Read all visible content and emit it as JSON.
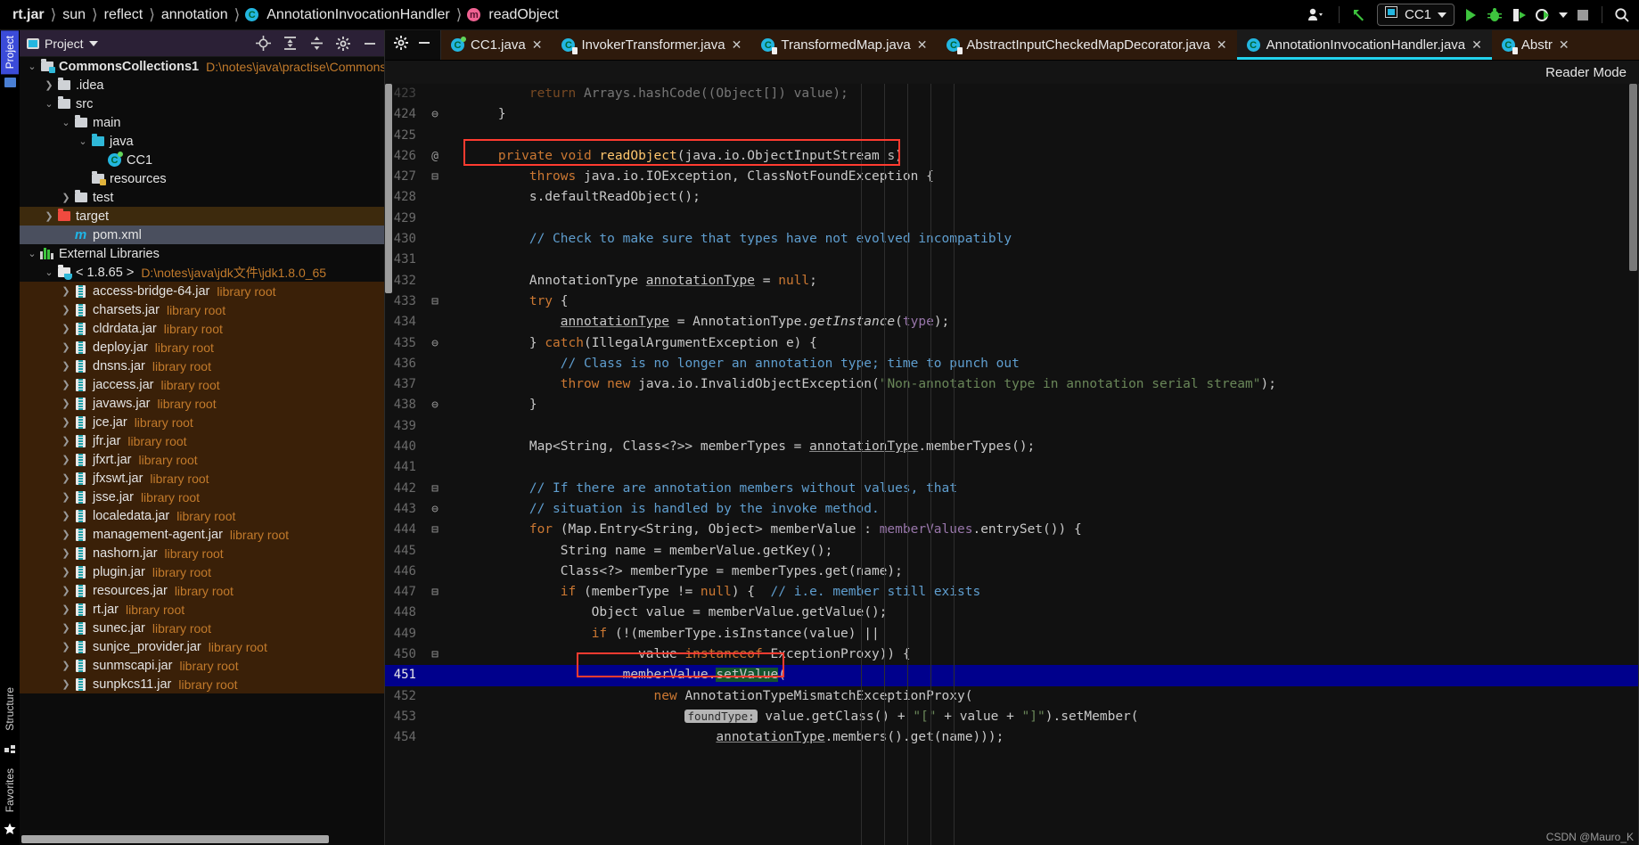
{
  "navbar": {
    "breadcrumbs": [
      "rt.jar",
      "sun",
      "reflect",
      "annotation",
      "AnnotationInvocationHandler",
      "readObject"
    ],
    "class_badge": "C",
    "method_badge": "m",
    "icons": [
      "user-dropdown-icon",
      "back-arrow-icon",
      "run-config-icon",
      "run-icon",
      "debug-icon",
      "run-coverage-icon",
      "profiler-icon",
      "stop-icon",
      "search-icon"
    ],
    "run_config": "CC1"
  },
  "left_strip": {
    "top_tabs": [
      "Project"
    ],
    "bottom_tabs": [
      "Structure",
      "Favorites"
    ]
  },
  "project_panel": {
    "title": "Project",
    "toolbar_icons": [
      "locate-icon",
      "expand-all-icon",
      "collapse-all-icon",
      "settings-gear-icon",
      "hide-icon"
    ],
    "tree": [
      {
        "indent": 0,
        "arrow": "v",
        "icon": "module-folder",
        "name": "CommonsCollections1",
        "bold": true,
        "sub": "D:\\notes\\java\\practise\\Commons",
        "state": "normal"
      },
      {
        "indent": 1,
        "arrow": ">",
        "icon": "folder",
        "name": ".idea",
        "sub": "",
        "state": "normal"
      },
      {
        "indent": 1,
        "arrow": "v",
        "icon": "folder",
        "name": "src",
        "sub": "",
        "state": "normal"
      },
      {
        "indent": 2,
        "arrow": "v",
        "icon": "folder",
        "name": "main",
        "sub": "",
        "state": "normal"
      },
      {
        "indent": 3,
        "arrow": "v",
        "icon": "folder-source",
        "name": "java",
        "sub": "",
        "state": "normal"
      },
      {
        "indent": 4,
        "arrow": "",
        "icon": "java-class-run",
        "name": "CC1",
        "sub": "",
        "state": "normal"
      },
      {
        "indent": 3,
        "arrow": "",
        "icon": "folder-resources",
        "name": "resources",
        "sub": "",
        "state": "normal"
      },
      {
        "indent": 2,
        "arrow": ">",
        "icon": "folder",
        "name": "test",
        "sub": "",
        "state": "normal"
      },
      {
        "indent": 1,
        "arrow": ">",
        "icon": "folder-excluded",
        "name": "target",
        "sub": "",
        "state": "highlight"
      },
      {
        "indent": 2,
        "arrow": "",
        "icon": "maven-m",
        "name": "pom.xml",
        "sub": "",
        "state": "selected"
      },
      {
        "indent": 0,
        "arrow": "v",
        "icon": "libraries",
        "name": "External Libraries",
        "sub": "",
        "state": "normal"
      },
      {
        "indent": 1,
        "arrow": "v",
        "icon": "jdk",
        "name": "< 1.8.65 >",
        "sub": "D:\\notes\\java\\jdk文件\\jdk1.8.0_65",
        "state": "normal"
      },
      {
        "indent": 2,
        "arrow": ">",
        "icon": "jar",
        "name": "access-bridge-64.jar",
        "sub": "library root",
        "state": "lib"
      },
      {
        "indent": 2,
        "arrow": ">",
        "icon": "jar",
        "name": "charsets.jar",
        "sub": "library root",
        "state": "lib"
      },
      {
        "indent": 2,
        "arrow": ">",
        "icon": "jar",
        "name": "cldrdata.jar",
        "sub": "library root",
        "state": "lib"
      },
      {
        "indent": 2,
        "arrow": ">",
        "icon": "jar",
        "name": "deploy.jar",
        "sub": "library root",
        "state": "lib"
      },
      {
        "indent": 2,
        "arrow": ">",
        "icon": "jar",
        "name": "dnsns.jar",
        "sub": "library root",
        "state": "lib"
      },
      {
        "indent": 2,
        "arrow": ">",
        "icon": "jar",
        "name": "jaccess.jar",
        "sub": "library root",
        "state": "lib"
      },
      {
        "indent": 2,
        "arrow": ">",
        "icon": "jar",
        "name": "javaws.jar",
        "sub": "library root",
        "state": "lib"
      },
      {
        "indent": 2,
        "arrow": ">",
        "icon": "jar",
        "name": "jce.jar",
        "sub": "library root",
        "state": "lib"
      },
      {
        "indent": 2,
        "arrow": ">",
        "icon": "jar",
        "name": "jfr.jar",
        "sub": "library root",
        "state": "lib"
      },
      {
        "indent": 2,
        "arrow": ">",
        "icon": "jar",
        "name": "jfxrt.jar",
        "sub": "library root",
        "state": "lib"
      },
      {
        "indent": 2,
        "arrow": ">",
        "icon": "jar",
        "name": "jfxswt.jar",
        "sub": "library root",
        "state": "lib"
      },
      {
        "indent": 2,
        "arrow": ">",
        "icon": "jar",
        "name": "jsse.jar",
        "sub": "library root",
        "state": "lib"
      },
      {
        "indent": 2,
        "arrow": ">",
        "icon": "jar",
        "name": "localedata.jar",
        "sub": "library root",
        "state": "lib"
      },
      {
        "indent": 2,
        "arrow": ">",
        "icon": "jar",
        "name": "management-agent.jar",
        "sub": "library root",
        "state": "lib"
      },
      {
        "indent": 2,
        "arrow": ">",
        "icon": "jar",
        "name": "nashorn.jar",
        "sub": "library root",
        "state": "lib"
      },
      {
        "indent": 2,
        "arrow": ">",
        "icon": "jar",
        "name": "plugin.jar",
        "sub": "library root",
        "state": "lib"
      },
      {
        "indent": 2,
        "arrow": ">",
        "icon": "jar",
        "name": "resources.jar",
        "sub": "library root",
        "state": "lib"
      },
      {
        "indent": 2,
        "arrow": ">",
        "icon": "jar",
        "name": "rt.jar",
        "sub": "library root",
        "state": "lib"
      },
      {
        "indent": 2,
        "arrow": ">",
        "icon": "jar",
        "name": "sunec.jar",
        "sub": "library root",
        "state": "lib"
      },
      {
        "indent": 2,
        "arrow": ">",
        "icon": "jar",
        "name": "sunjce_provider.jar",
        "sub": "library root",
        "state": "lib"
      },
      {
        "indent": 2,
        "arrow": ">",
        "icon": "jar",
        "name": "sunmscapi.jar",
        "sub": "library root",
        "state": "lib"
      },
      {
        "indent": 2,
        "arrow": ">",
        "icon": "jar",
        "name": "sunpkcs11.jar",
        "sub": "library root",
        "state": "lib"
      }
    ]
  },
  "editor": {
    "reader_mode": "Reader Mode",
    "tabs": [
      {
        "label": "CC1.java",
        "icon": "java-class-run",
        "active": false
      },
      {
        "label": "InvokerTransformer.java",
        "icon": "java-class-lock",
        "active": false
      },
      {
        "label": "TransformedMap.java",
        "icon": "java-class-lock",
        "active": false
      },
      {
        "label": "AbstractInputCheckedMapDecorator.java",
        "icon": "java-class-lock",
        "active": false
      },
      {
        "label": "AnnotationInvocationHandler.java",
        "icon": "java-class",
        "active": true
      },
      {
        "label": "Abstr",
        "icon": "java-class-lock",
        "active": false
      }
    ],
    "current_line": 451,
    "search_highlight": "setValue",
    "inlay_hint": "foundType:",
    "lines": [
      {
        "n": 423,
        "mark": "",
        "clipped": true,
        "html": "        <span class=\"kw\">return</span> Arrays.hashCode((Object[]) value);"
      },
      {
        "n": 424,
        "mark": "⊖",
        "html": "    }"
      },
      {
        "n": 425,
        "mark": "",
        "html": ""
      },
      {
        "n": 426,
        "mark": "@",
        "html": "    <span class=\"kw\">private</span> <span class=\"kw\">void</span> <span class=\"mth\">readObject</span>(java.io.ObjectInputStream <span class=\"param\">s</span>)",
        "box": "red"
      },
      {
        "n": 427,
        "mark": "⊟",
        "html": "        <span class=\"kw\">throws</span> java.io.IOException, ClassNotFoundException {"
      },
      {
        "n": 428,
        "mark": "",
        "html": "        s.defaultReadObject();"
      },
      {
        "n": 429,
        "mark": "",
        "html": ""
      },
      {
        "n": 430,
        "mark": "",
        "html": "        <span class=\"cmt\">// Check to make sure that types have not evolved incompatibly</span>"
      },
      {
        "n": 431,
        "mark": "",
        "html": ""
      },
      {
        "n": 432,
        "mark": "",
        "html": "        AnnotationType <span class=\"und\">annotationType</span> = <span class=\"kw\">null</span>;"
      },
      {
        "n": 433,
        "mark": "⊟",
        "html": "        <span class=\"kw\">try</span> {"
      },
      {
        "n": 434,
        "mark": "",
        "html": "            <span class=\"und\">annotationType</span> = AnnotationType.<span class=\"ital\">getInstance</span>(<span class=\"fld\">type</span>);"
      },
      {
        "n": 435,
        "mark": "⊖",
        "html": "        } <span class=\"kw\">catch</span>(IllegalArgumentException e) {"
      },
      {
        "n": 436,
        "mark": "",
        "html": "            <span class=\"cmt\">// Class is no longer an annotation type; time to punch out</span>"
      },
      {
        "n": 437,
        "mark": "",
        "html": "            <span class=\"kw\">throw</span> <span class=\"kw\">new</span> java.io.InvalidObjectException(<span class=\"str\">\"Non-annotation type in annotation serial stream\"</span>);"
      },
      {
        "n": 438,
        "mark": "⊖",
        "html": "        }"
      },
      {
        "n": 439,
        "mark": "",
        "html": ""
      },
      {
        "n": 440,
        "mark": "",
        "html": "        Map&lt;String, Class&lt;?&gt;&gt; memberTypes = <span class=\"und\">annotationType</span>.memberTypes();"
      },
      {
        "n": 441,
        "mark": "",
        "html": ""
      },
      {
        "n": 442,
        "mark": "⊟",
        "html": "        <span class=\"cmt\">// If there are annotation members without values, that</span>"
      },
      {
        "n": 443,
        "mark": "⊖",
        "html": "        <span class=\"cmt\">// situation is handled by the invoke method.</span>"
      },
      {
        "n": 444,
        "mark": "⊟",
        "html": "        <span class=\"kw\">for</span> (Map.Entry&lt;String, Object&gt; memberValue : <span class=\"fld\">memberValues</span>.entrySet()) {"
      },
      {
        "n": 445,
        "mark": "",
        "html": "            String name = memberValue.getKey();"
      },
      {
        "n": 446,
        "mark": "",
        "html": "            Class&lt;?&gt; memberType = memberTypes.get(name);"
      },
      {
        "n": 447,
        "mark": "⊟",
        "html": "            <span class=\"kw\">if</span> (memberType != <span class=\"kw\">null</span>) {  <span class=\"cmt\">// i.e. member still exists</span>"
      },
      {
        "n": 448,
        "mark": "",
        "html": "                Object value = memberValue.getValue();"
      },
      {
        "n": 449,
        "mark": "",
        "html": "                <span class=\"kw\">if</span> (!(memberType.isInstance(value) ||"
      },
      {
        "n": 450,
        "mark": "⊟",
        "html": "                      value <span class=\"kw\">instanceof</span> ExceptionProxy)) {"
      },
      {
        "n": 451,
        "mark": "",
        "cursor": true,
        "html": "                    memberValue.<span class=\"greenhl\">setValue</span>(",
        "box": "red2"
      },
      {
        "n": 452,
        "mark": "",
        "html": "                        <span class=\"kw\">new</span> AnnotationTypeMismatchExceptionProxy("
      },
      {
        "n": 453,
        "mark": "",
        "html": "                            <span class=\"hint\">foundType:</span> value.getClass() + <span class=\"str\">\"[\"</span> + value + <span class=\"str\">\"]\"</span>).setMember("
      },
      {
        "n": 454,
        "mark": "",
        "html": "                                <span class=\"und\">annotationType</span>.members().get(name)));"
      }
    ]
  },
  "watermark": "CSDN @Mauro_K"
}
